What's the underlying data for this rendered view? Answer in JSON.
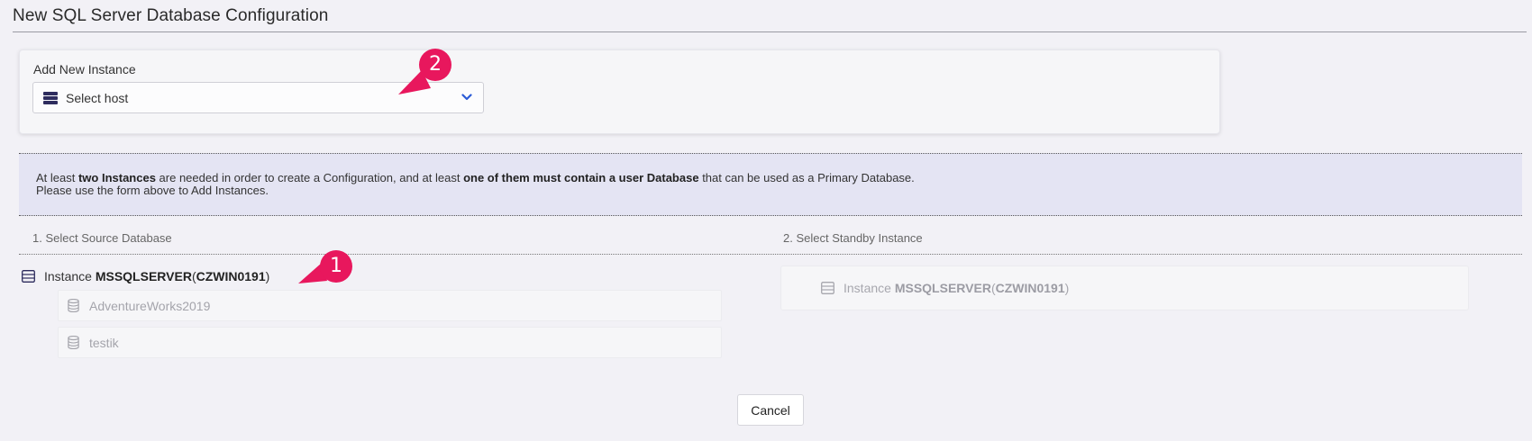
{
  "page": {
    "title": "New SQL Server Database Configuration"
  },
  "add_instance": {
    "label": "Add New Instance",
    "host_select": {
      "placeholder": "Select host",
      "icon": "server-stack-icon",
      "chevron": "chevron-down-icon"
    }
  },
  "info": {
    "line1_part1": "At least ",
    "line1_bold1": "two Instances",
    "line1_part2": " are needed in order to create a Configuration, and at least ",
    "line1_bold2": "one of them must contain a user Database",
    "line1_part3": " that can be used as a Primary Database.",
    "line2": "Please use the form above to Add Instances."
  },
  "source": {
    "header": "1. Select Source Database",
    "instance": {
      "prefix": "Instance ",
      "name": "MSSQLSERVER",
      "open": " (",
      "host": "CZWIN0191",
      "close": ")"
    },
    "databases": [
      {
        "name": "AdventureWorks2019"
      },
      {
        "name": "testik"
      }
    ]
  },
  "standby": {
    "header": "2. Select Standby Instance",
    "instance": {
      "prefix": "Instance ",
      "name": "MSSQLSERVER",
      "open": " (",
      "host": "CZWIN0191",
      "close": ")"
    }
  },
  "actions": {
    "cancel": "Cancel"
  },
  "callouts": [
    {
      "number": "1"
    },
    {
      "number": "2"
    }
  ],
  "colors": {
    "callout": "#e8175d",
    "accent_icon": "#2e2c5e",
    "chevron": "#2b5bd6"
  }
}
